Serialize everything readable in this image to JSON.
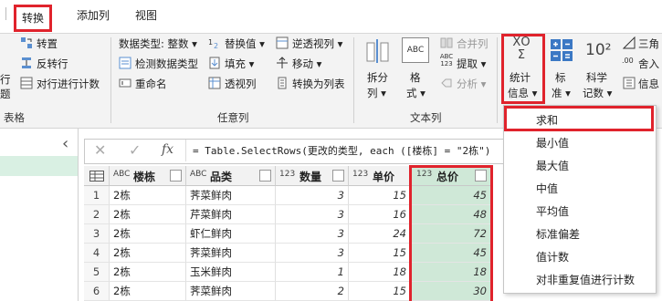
{
  "tabs": [
    {
      "label": "转换",
      "active": true
    },
    {
      "label": "添加列",
      "active": false
    },
    {
      "label": "视图",
      "active": false
    }
  ],
  "ribbon": {
    "left_fragments": {
      "line1": "行",
      "line2": "题"
    },
    "table_group": {
      "label": "表格",
      "items": [
        "转置",
        "反转行",
        "对行进行计数"
      ]
    },
    "any_column_group": {
      "label": "任意列",
      "data_type": "数据类型: 整数",
      "detect_type": "检测数据类型",
      "rename": "重命名",
      "replace_values": "替换值",
      "fill": "填充",
      "pivot": "透视列",
      "unpivot": "逆透视列",
      "move": "移动",
      "to_list": "转换为列表"
    },
    "text_column_group": {
      "label": "文本列",
      "split": [
        "拆分",
        "列"
      ],
      "format": [
        "格",
        "式"
      ],
      "merge": "合并列",
      "extract": "提取",
      "parse": "分析",
      "abc_icon_text": "ABC",
      "abc123_text": [
        "ABC",
        "123"
      ]
    },
    "number_group": {
      "statistics": [
        "统计",
        "信息"
      ],
      "standard": [
        "标",
        "准"
      ],
      "scientific": [
        "科学",
        "记数"
      ],
      "scientific_icon": "10²",
      "trig": "三角",
      "round": "舍入",
      "info": "信息",
      "round_icon": ".00"
    }
  },
  "formula_bar": {
    "formula": "= Table.SelectRows(更改的类型, each ([楼栋] = \"2栋\")",
    "cancel": "✕",
    "confirm": "✓",
    "fx": "fx",
    "collapse": "‹"
  },
  "table": {
    "columns": [
      {
        "type": "ABC",
        "name": "楼栋"
      },
      {
        "type": "ABC",
        "name": "品类"
      },
      {
        "type": "123",
        "name": "数量"
      },
      {
        "type": "123",
        "name": "单价"
      },
      {
        "type": "123",
        "name": "总价"
      }
    ],
    "rows": [
      {
        "n": "1",
        "c": [
          "2栋",
          "荠菜鲜肉",
          "3",
          "15",
          "45"
        ]
      },
      {
        "n": "2",
        "c": [
          "2栋",
          "芹菜鲜肉",
          "3",
          "16",
          "48"
        ]
      },
      {
        "n": "3",
        "c": [
          "2栋",
          "虾仁鲜肉",
          "3",
          "24",
          "72"
        ]
      },
      {
        "n": "4",
        "c": [
          "2栋",
          "荠菜鲜肉",
          "3",
          "15",
          "45"
        ]
      },
      {
        "n": "5",
        "c": [
          "2栋",
          "玉米鲜肉",
          "1",
          "18",
          "18"
        ]
      },
      {
        "n": "6",
        "c": [
          "2栋",
          "荠菜鲜肉",
          "2",
          "15",
          "30"
        ]
      }
    ]
  },
  "stats_menu": {
    "items": [
      "求和",
      "最小值",
      "最大值",
      "中值",
      "平均值",
      "标准偏差",
      "值计数",
      "对非重复值进行计数"
    ]
  },
  "colors": {
    "highlight_red": "#e0232c",
    "selected_column": "#cfe8d7",
    "ribbon_bg": "#f3f3f3",
    "query_pane_green": "#d9f0e3"
  }
}
